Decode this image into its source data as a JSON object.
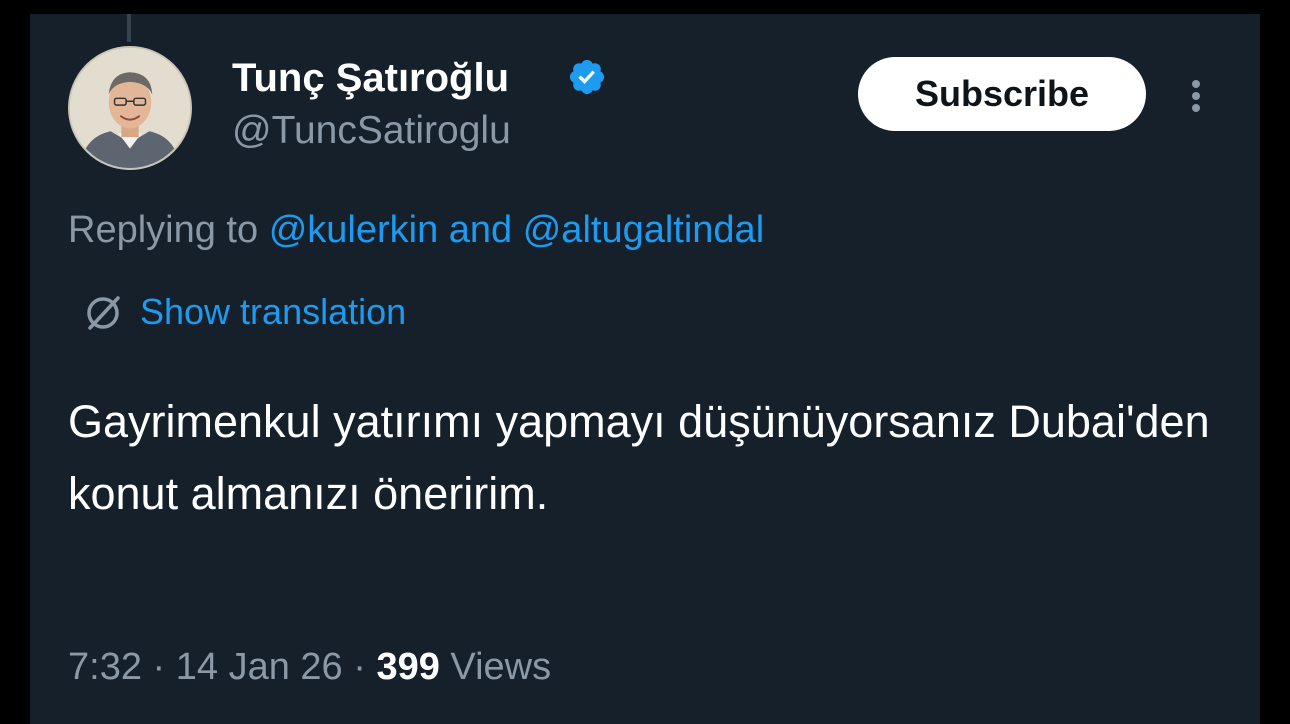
{
  "author": {
    "display_name": "Tunç Şatıroğlu",
    "handle": "@TuncSatiroglu",
    "verified": true,
    "avatar_icon": "profile-photo"
  },
  "actions": {
    "subscribe_label": "Subscribe",
    "more_icon": "more-vertical-icon"
  },
  "reply": {
    "prefix": "Replying to",
    "mention_1": "@kulerkin",
    "connector": "and",
    "mention_2": "@altugaltindal"
  },
  "translation": {
    "label": "Show translation",
    "icon": "globe-translate-icon"
  },
  "tweet": {
    "text": "Gayrimenkul yatırımı yapmayı düşünüyorsanız Dubai'den konut almanızı öneririm."
  },
  "meta": {
    "time": "7:32",
    "separator": "·",
    "date": "14 Jan 26",
    "views_count": "399",
    "views_label": "Views"
  },
  "colors": {
    "background": "#15202b",
    "text_primary": "#ffffff",
    "text_secondary": "#8b98a5",
    "accent": "#1d9bf0"
  }
}
